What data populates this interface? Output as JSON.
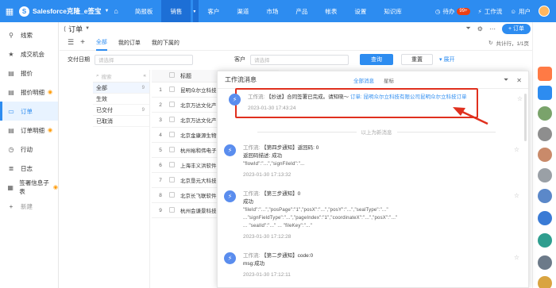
{
  "topbar": {
    "brand": "Salesforce克隆_e签宝",
    "nav": [
      "简报板",
      "销售",
      "客户",
      "渠道",
      "市场",
      "产品",
      "帐表",
      "设置",
      "知识库"
    ],
    "active_nav": "销售",
    "todo_label": "待办",
    "todo_badge": "99+",
    "workflow_label": "工作流",
    "user_label": "用户",
    "colors": {
      "bar": "#2d8cf0",
      "active_nav": "#1d6fd6"
    }
  },
  "sidebar": {
    "items": [
      {
        "icon": "pin-icon",
        "label": "线索"
      },
      {
        "icon": "star-icon",
        "label": "成交机会"
      },
      {
        "icon": "doc-icon",
        "label": "报价"
      },
      {
        "icon": "doc-icon",
        "label": "报价明细",
        "eye": true
      },
      {
        "icon": "folder-icon",
        "label": "订单",
        "active": true
      },
      {
        "icon": "doc-icon",
        "label": "订单明细",
        "eye": true
      },
      {
        "icon": "clock-icon",
        "label": "行动"
      },
      {
        "icon": "list-icon",
        "label": "日志"
      },
      {
        "icon": "grid-icon",
        "label": "签署信息子表",
        "eye": true
      },
      {
        "icon": "plus-icon",
        "label": "新建",
        "muted": true
      }
    ]
  },
  "main": {
    "title": "订单",
    "new_button": "+ 订单",
    "tabs": [
      "全部",
      "我的订单",
      "我的下属的"
    ],
    "active_tab": "全部",
    "pager": "共计行，1/1页",
    "filter": {
      "date_label": "交付日期",
      "date_placeholder": "请选择",
      "customer_label": "客户",
      "customer_placeholder": "请选择",
      "query_button": "查询",
      "reset_button": "重置",
      "expand_label": "展开"
    },
    "status_search_placeholder": "搜索",
    "status_list": [
      {
        "label": "全部",
        "count": "9",
        "active": true
      },
      {
        "label": "生效",
        "count": ""
      },
      {
        "label": "已交付",
        "count": "9"
      },
      {
        "label": "已取消",
        "count": ""
      }
    ],
    "table": {
      "header_title": "标题",
      "rows": [
        {
          "num": "1",
          "title": "昆明众尔立科技"
        },
        {
          "num": "2",
          "title": "北京万达文化产"
        },
        {
          "num": "3",
          "title": "北京万达文化产"
        },
        {
          "num": "4",
          "title": "北京金康源生物"
        },
        {
          "num": "5",
          "title": "杭州裕和伟电子"
        },
        {
          "num": "6",
          "title": "上海丰义洪软件"
        },
        {
          "num": "7",
          "title": "北京垦元大科技"
        },
        {
          "num": "8",
          "title": "北京长飞联软件"
        },
        {
          "num": "9",
          "title": "杭州会谦景科技"
        }
      ]
    }
  },
  "panel": {
    "title": "工作流消息",
    "tabs": [
      "全部消息",
      "星标"
    ],
    "active_tab": "全部消息",
    "divider_text": "以上为新消息",
    "messages": [
      {
        "prefix": "工作流:",
        "text": "【抄送】合同签署已完成。请知晓～",
        "link": "订单: 昆明众尔立科技有限公司昆明众尔立科技订单",
        "time": "2023-01-30 17:43:24"
      },
      {
        "prefix": "工作流:",
        "text": "【第四步通知】返回码: 0",
        "line2": "返回码描述: 成功",
        "scribble": "\"flowId\":\"...\",\"signFileId\":\"...",
        "time": "2023-01-30 17:13:32"
      },
      {
        "prefix": "工作流:",
        "text": "【第三步通知】0",
        "line2": "成功",
        "scribble": "\"fileId\":\"...\",\"posPage\":\"1\",\"posX\":\"...\",\"posY\":\"...\",\"sealType\":\"...\"",
        "scribble2": "...\"signFieldType\":\"...\",\"pageIndex\":\"1\",\"coordinateX\":\"...\",\"posX\":\"...\"",
        "scribble3": "... \"sealId\":\"...\" ... \"fileKey\":\"...\"",
        "time": "2023-01-30 17:12:28"
      },
      {
        "prefix": "工作流:",
        "text": "【第二步通知】code:0",
        "line2": "msg:成功",
        "time": "2023-01-30 17:12:11"
      }
    ]
  }
}
